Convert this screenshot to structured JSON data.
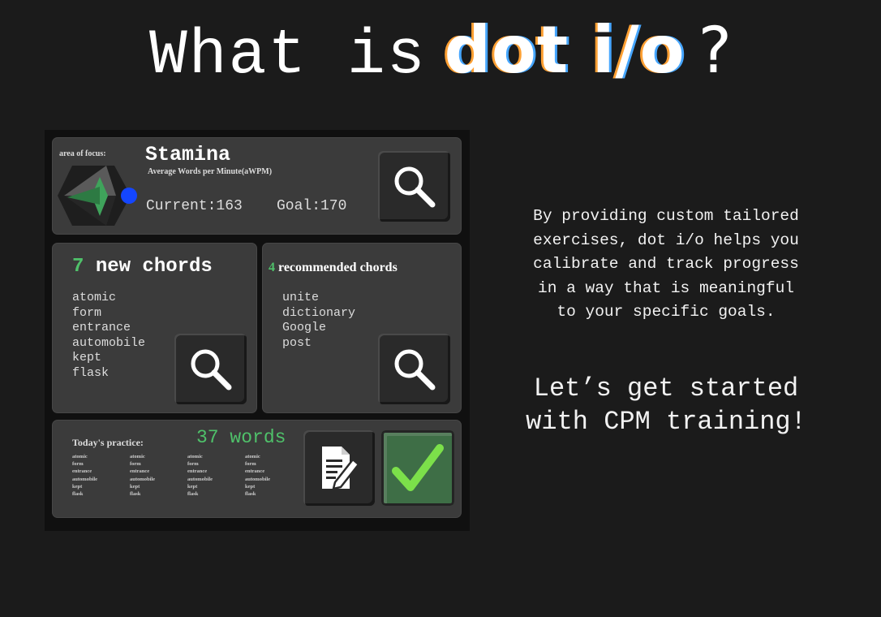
{
  "title": {
    "prefix": "What is",
    "brand": "dot i/o",
    "suffix": "?"
  },
  "focus": {
    "label": "area of focus:",
    "name": "Stamina",
    "metric": "Average Words per Minute(aWPM)",
    "current": "Current:163",
    "goal": "Goal:170"
  },
  "new_chords": {
    "count": "7",
    "label": "new chords",
    "words": [
      "atomic",
      "form",
      "entrance",
      "automobile",
      "kept",
      "flask"
    ]
  },
  "recommended_chords": {
    "count": "4",
    "label": "recommended chords",
    "words": [
      "unite",
      "dictionary",
      "Google",
      "post"
    ]
  },
  "practice": {
    "label": "Today's practice:",
    "count": "37 words",
    "columns": [
      [
        "atomic",
        "form",
        "entrance",
        "automobile",
        "kept",
        "flask"
      ],
      [
        "atomic",
        "form",
        "entrance",
        "automobile",
        "kept",
        "flask"
      ],
      [
        "atomic",
        "form",
        "entrance",
        "automobile",
        "kept",
        "flask"
      ],
      [
        "atomic",
        "form",
        "entrance",
        "automobile",
        "kept",
        "flask"
      ]
    ]
  },
  "description": "By providing custom tailored\nexercises, dot i/o helps you\ncalibrate and track progress\nin a way that is meaningful\nto your specific goals.",
  "cta": "Let’s get started\nwith CPM training!",
  "icons": {
    "search": "magnifier-icon",
    "edit": "document-edit-icon",
    "confirm": "checkmark-icon",
    "focus": "star-shape-icon"
  },
  "colors": {
    "accent_green": "#4fc16a",
    "checkmark": "#7ce04a",
    "dot_blue": "#1446ff"
  }
}
